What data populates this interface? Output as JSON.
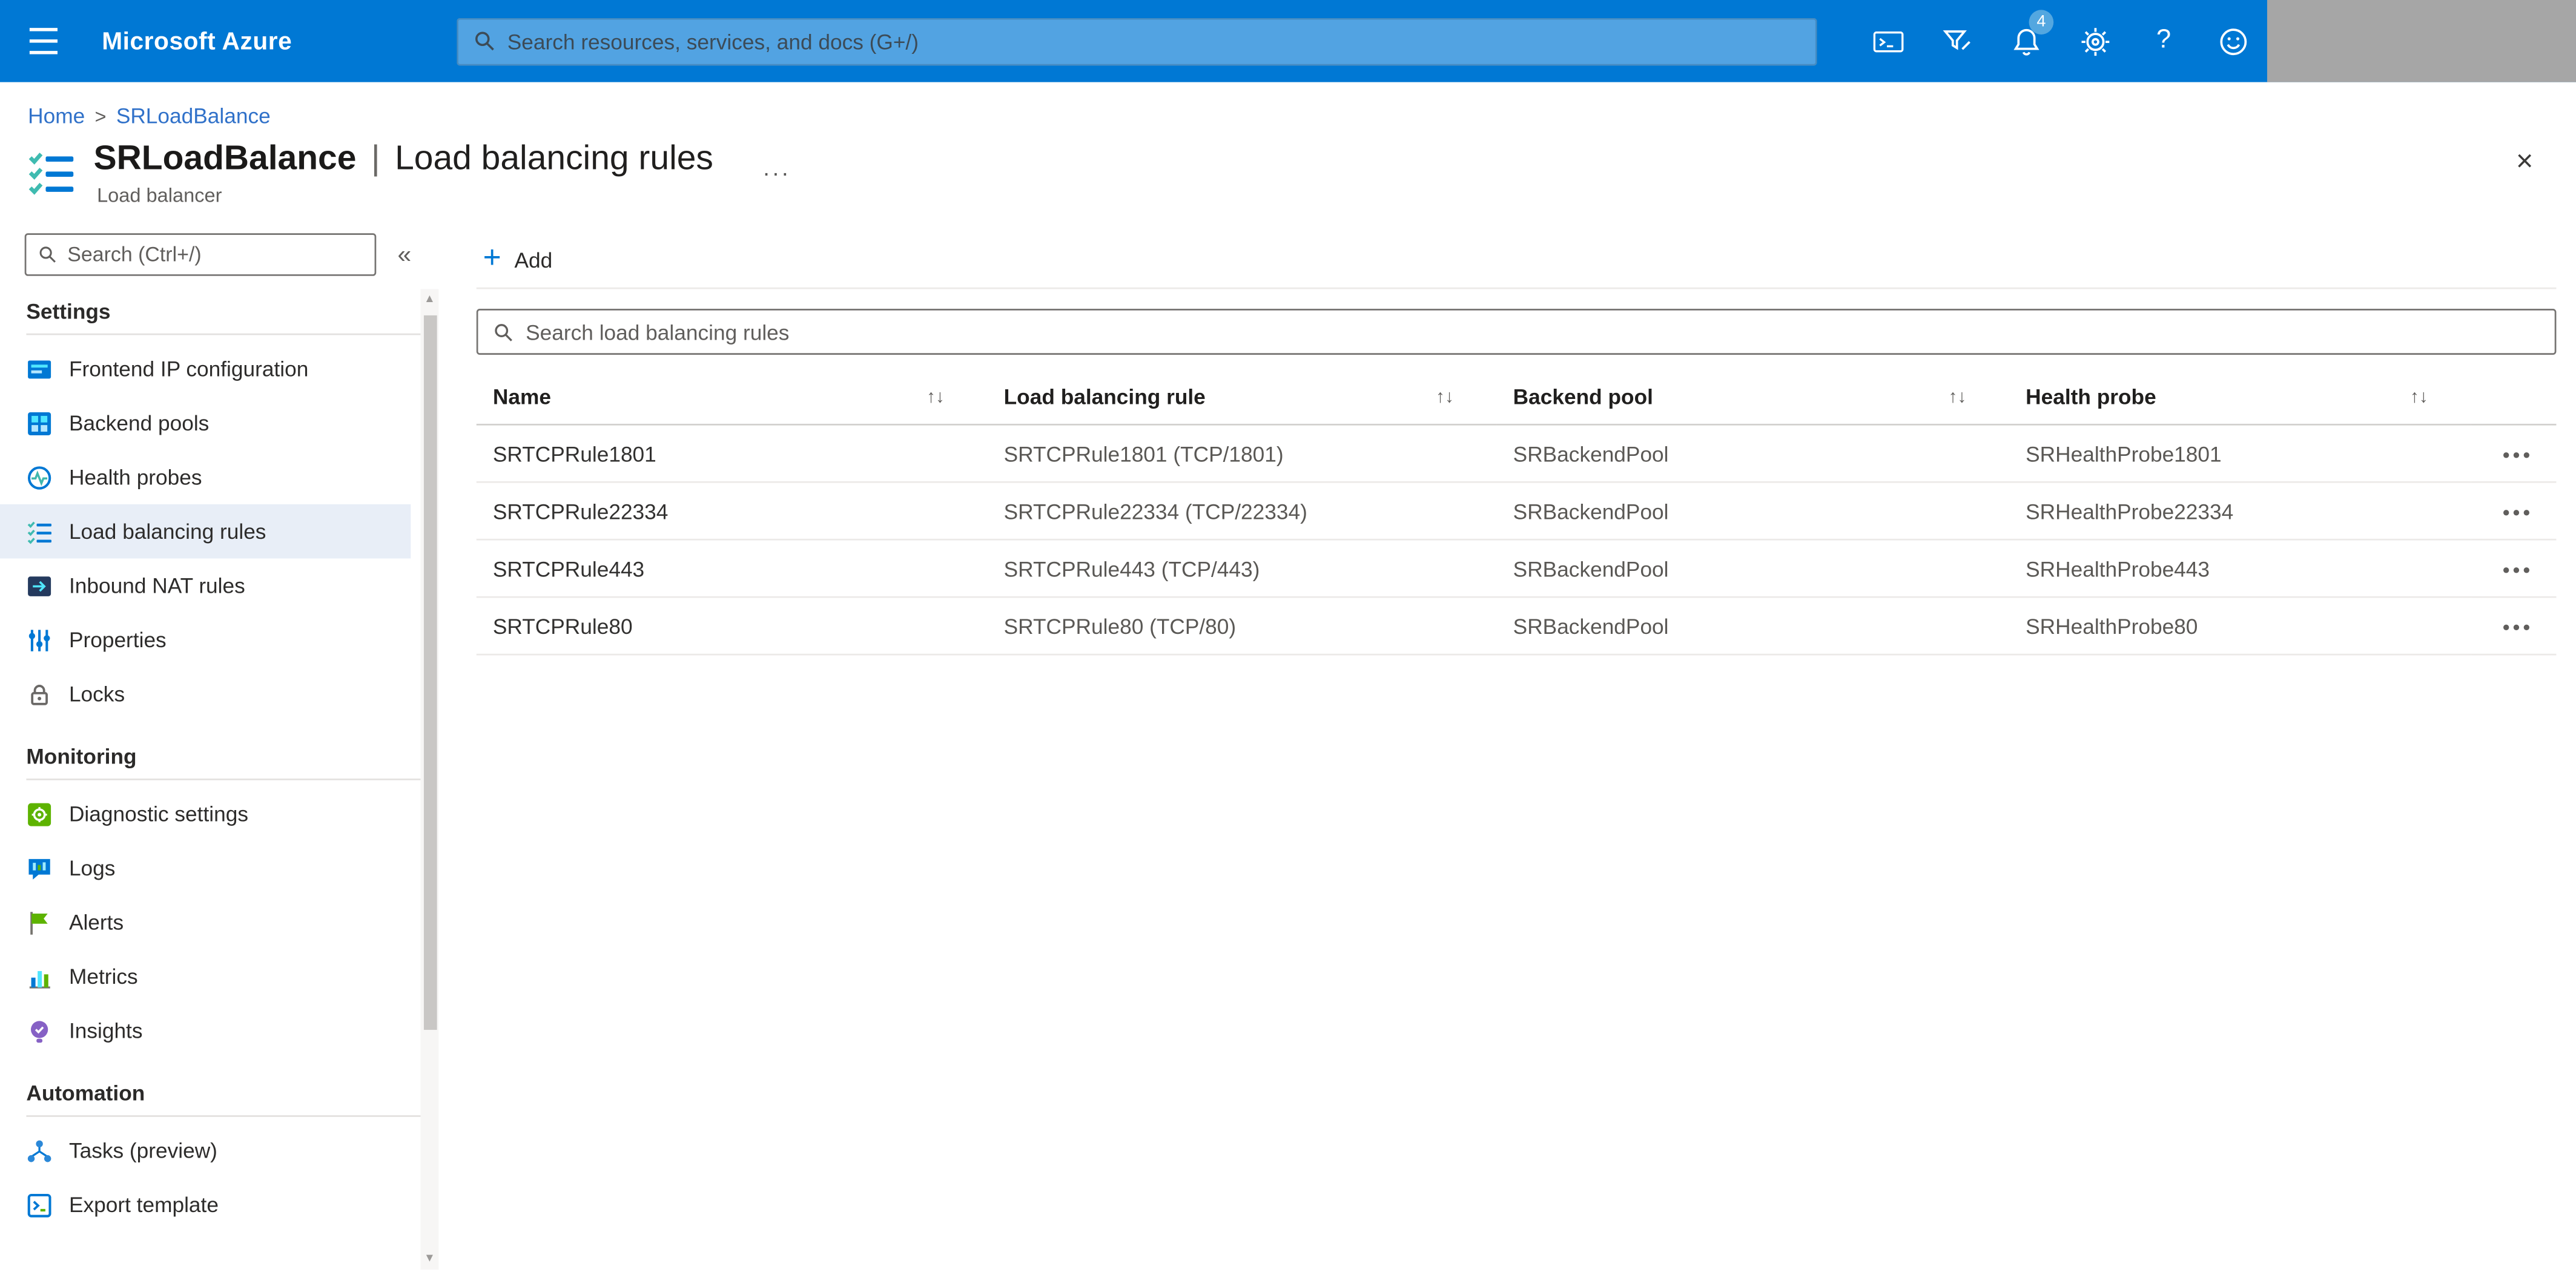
{
  "topbar": {
    "brand": "Microsoft Azure",
    "search_placeholder": "Search resources, services, and docs (G+/)",
    "notification_count": "4",
    "help_glyph": "?"
  },
  "breadcrumb": {
    "home": "Home",
    "separator": ">",
    "current": "SRLoadBalance"
  },
  "page": {
    "resource_name": "SRLoadBalance",
    "separator": "|",
    "blade_name": "Load balancing rules",
    "resource_type": "Load balancer",
    "more_glyph": "···",
    "close_glyph": "×"
  },
  "sidebar": {
    "search_placeholder": "Search (Ctrl+/)",
    "collapse_glyph": "«",
    "sections": [
      {
        "title": "Settings",
        "items": [
          {
            "label": "Frontend IP configuration"
          },
          {
            "label": "Backend pools"
          },
          {
            "label": "Health probes"
          },
          {
            "label": "Load balancing rules",
            "selected": true
          },
          {
            "label": "Inbound NAT rules"
          },
          {
            "label": "Properties"
          },
          {
            "label": "Locks"
          }
        ]
      },
      {
        "title": "Monitoring",
        "items": [
          {
            "label": "Diagnostic settings"
          },
          {
            "label": "Logs"
          },
          {
            "label": "Alerts"
          },
          {
            "label": "Metrics"
          },
          {
            "label": "Insights"
          }
        ]
      },
      {
        "title": "Automation",
        "items": [
          {
            "label": "Tasks (preview)"
          },
          {
            "label": "Export template"
          }
        ]
      }
    ]
  },
  "toolbar": {
    "add_glyph": "+",
    "add_label": "Add"
  },
  "rules": {
    "search_placeholder": "Search load balancing rules",
    "columns": [
      "Name",
      "Load balancing rule",
      "Backend pool",
      "Health probe"
    ],
    "sort_glyph": "↑↓",
    "row_menu_glyph": "•••",
    "rows": [
      {
        "name": "SRTCPRule1801",
        "rule": "SRTCPRule1801 (TCP/1801)",
        "backend_pool": "SRBackendPool",
        "health_probe": "SRHealthProbe1801"
      },
      {
        "name": "SRTCPRule22334",
        "rule": "SRTCPRule22334 (TCP/22334)",
        "backend_pool": "SRBackendPool",
        "health_probe": "SRHealthProbe22334"
      },
      {
        "name": "SRTCPRule443",
        "rule": "SRTCPRule443 (TCP/443)",
        "backend_pool": "SRBackendPool",
        "health_probe": "SRHealthProbe443"
      },
      {
        "name": "SRTCPRule80",
        "rule": "SRTCPRule80 (TCP/80)",
        "backend_pool": "SRBackendPool",
        "health_probe": "SRHealthProbe80"
      }
    ]
  },
  "scrollbar": {
    "up_glyph": "▲",
    "down_glyph": "▼"
  },
  "colors": {
    "brand_blue": "#0078d4",
    "link_blue": "#3071c9",
    "selected_item_bg": "#e8eef7",
    "text_primary": "#323130",
    "text_secondary": "#605e5c",
    "redacted_gray": "#a6a6a6"
  }
}
